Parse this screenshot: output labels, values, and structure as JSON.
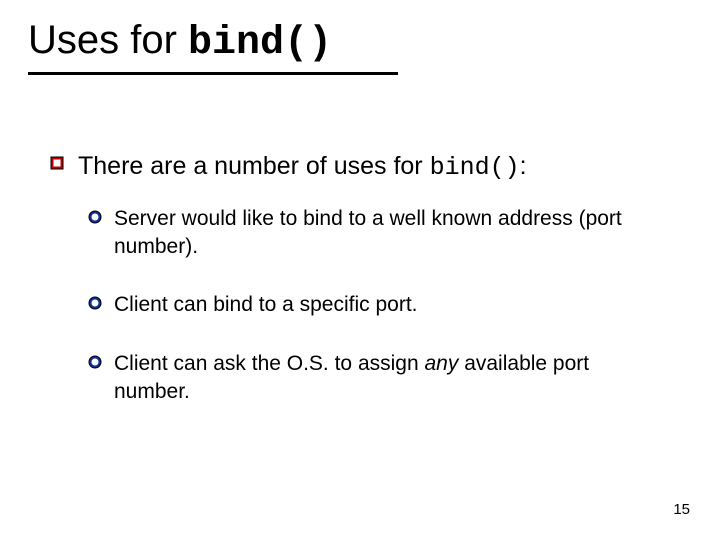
{
  "title": {
    "prefix": "Uses for ",
    "code": "bind()"
  },
  "main": {
    "prefix": "There are a number of uses for ",
    "code": "bind()",
    "suffix": ":"
  },
  "subs": [
    {
      "plain": "Server would like to bind to a well known address (port number)."
    },
    {
      "plain": "Client can bind to a specific port."
    },
    {
      "pre": "Client can ask the O.S. to assign ",
      "em": "any",
      "post": " available port number."
    }
  ],
  "page_number": "15"
}
